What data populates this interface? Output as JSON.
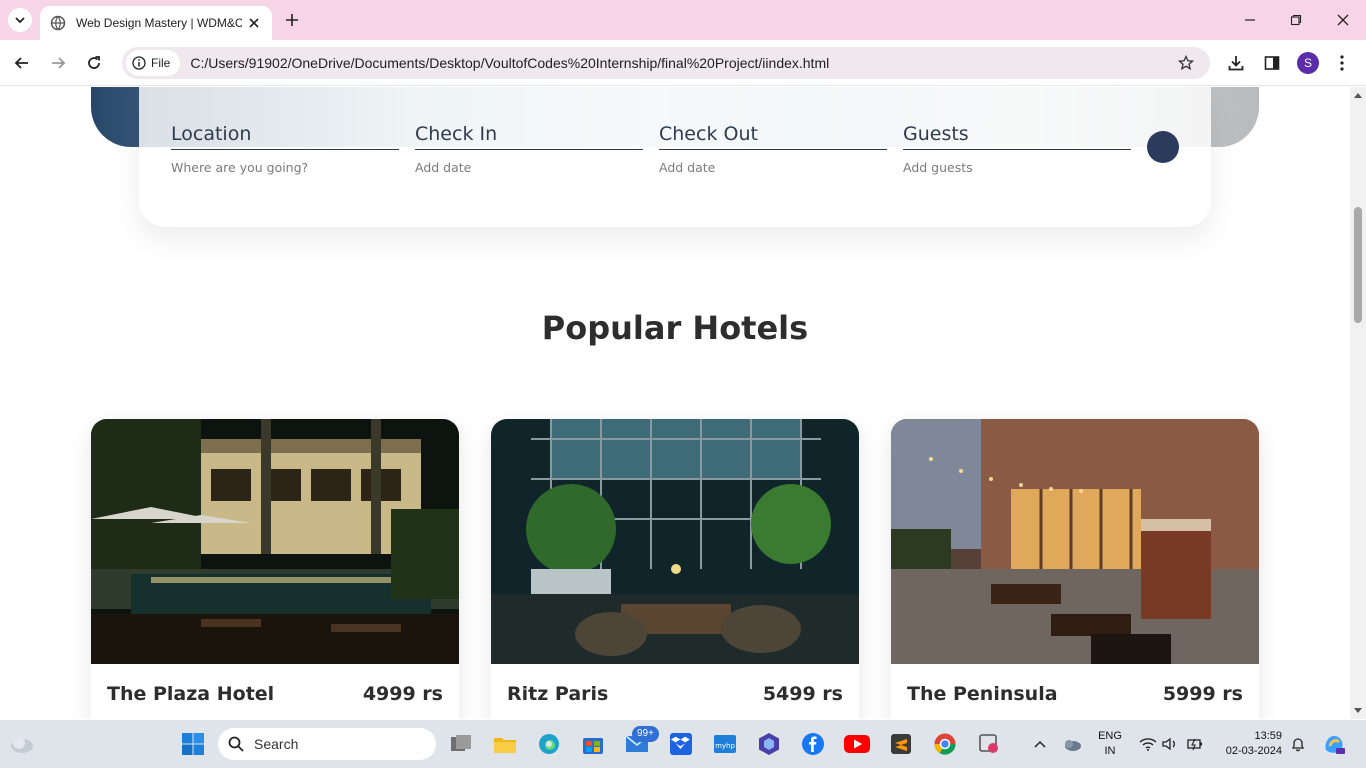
{
  "browser": {
    "tab_title": "Web Design Mastery | WDM&C",
    "site_chip_label": "File",
    "url": "C:/Users/91902/OneDrive/Documents/Desktop/VoultofCodes%20Internship/final%20Project/iindex.html",
    "profile_initial": "S"
  },
  "booking": {
    "fields": [
      {
        "label": "Location",
        "hint": "Where are you going?"
      },
      {
        "label": "Check In",
        "hint": "Add date"
      },
      {
        "label": "Check Out",
        "hint": "Add date"
      },
      {
        "label": "Guests",
        "hint": "Add guests"
      }
    ]
  },
  "section": {
    "title": "Popular Hotels"
  },
  "hotels": [
    {
      "name": "The Plaza Hotel",
      "price": "4999 rs"
    },
    {
      "name": "Ritz Paris",
      "price": "5499 rs"
    },
    {
      "name": "The Peninsula",
      "price": "5999 rs"
    }
  ],
  "taskbar": {
    "search_placeholder": "Search",
    "mail_badge": "99+",
    "language_line1": "ENG",
    "language_line2": "IN",
    "time": "13:59",
    "date": "02-03-2024"
  },
  "colors": {
    "tabbar": "#f6d6e6",
    "accent_dark": "#2b3b5e",
    "heading": "#2d2d2d"
  }
}
